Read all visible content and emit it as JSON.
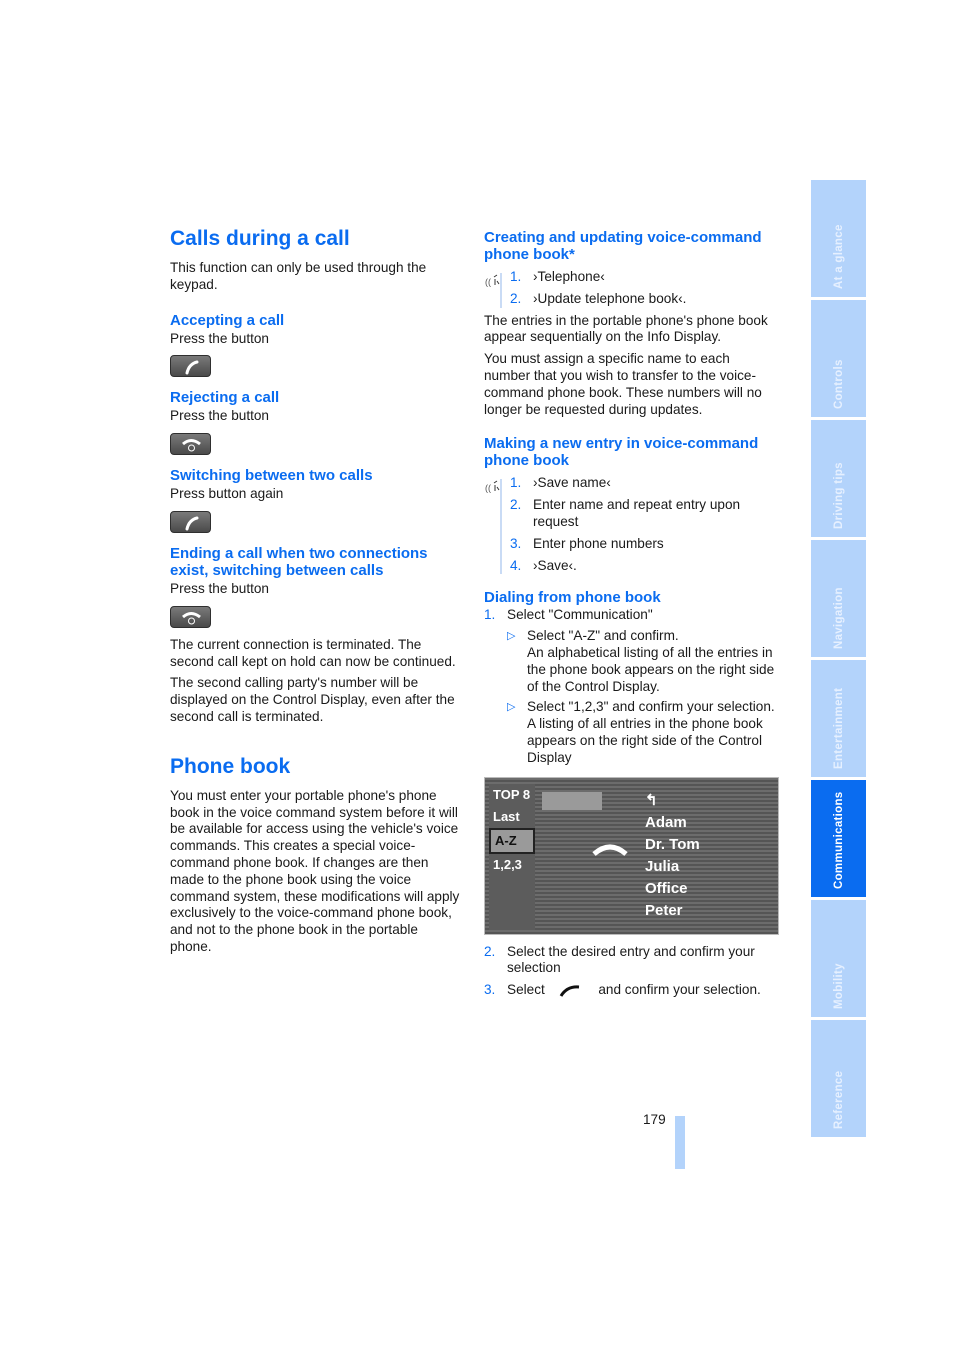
{
  "left": {
    "title": "Calls during a call",
    "intro": "This function can only be used through the keypad.",
    "sections": [
      {
        "heading": "Accepting a call",
        "text": "Press the button",
        "button": "call-accept"
      },
      {
        "heading": "Rejecting a call",
        "text": "Press the button",
        "button": "call-end"
      },
      {
        "heading": "Switching between two calls",
        "text": "Press button again",
        "button": "call-accept"
      },
      {
        "heading": "Ending a call when two connections exist, switching between calls",
        "text": "Press the button",
        "button": "call-end"
      }
    ],
    "para1": "The current connection is terminated. The second call kept on hold can now be continued.",
    "para2": "The second calling party's number will be displayed on the Control Display, even after the second call is terminated.",
    "phonebook_title": "Phone book",
    "phonebook_text": "You must enter your portable phone's phone book in the voice command system before it will be available for access using the vehicle's voice commands. This creates a special voice-command phone book. If changes are then made to the phone book using the voice command system, these modifications will apply exclusively to the voice-command phone book, and not to the phone book in the portable phone."
  },
  "right": {
    "creating_heading": "Creating and updating voice-command phone book*",
    "creating_steps": [
      {
        "num": "1.",
        "text": "›Telephone‹"
      },
      {
        "num": "2.",
        "text": "›Update telephone book‹."
      }
    ],
    "para1": "The entries in the portable phone's phone book appear sequentially on the Info Display.",
    "para2": "You must assign a specific name to each number that you wish to transfer to the voice-command phone book. These numbers will no longer be requested during updates.",
    "making_heading": "Making a new entry in voice-command phone book",
    "making_steps": [
      {
        "num": "1.",
        "text": "›Save name‹"
      },
      {
        "num": "2.",
        "text": "Enter name and repeat entry upon request"
      },
      {
        "num": "3.",
        "text": "Enter phone numbers"
      },
      {
        "num": "4.",
        "text": "›Save‹."
      }
    ],
    "dialing_heading": "Dialing from phone book",
    "dialing_step1": {
      "num": "1.",
      "text": "Select \"Communication\""
    },
    "dialing_subs": [
      "Select \"A-Z\" and confirm.\nAn alphabetical listing of all the entries in the phone book appears on the right side of the Control Display.",
      "Select \"1,2,3\" and confirm your selection.\nA listing of all entries in the phone book appears on the right side of the Control Display"
    ],
    "screen": {
      "menu": [
        "TOP 8",
        "Last",
        "A-Z",
        "1,2,3"
      ],
      "selected": "A-Z",
      "names": [
        "Adam",
        "Dr. Tom",
        "Julia",
        "Office",
        "Peter"
      ]
    },
    "dialing_step2": {
      "num": "2.",
      "text": "Select the desired entry and confirm your selection"
    },
    "dialing_step3": {
      "num": "3.",
      "text_before": "Select",
      "text_after": "and confirm your selection."
    }
  },
  "page_number": "179",
  "tabs": [
    {
      "label": "At a glance",
      "active": false
    },
    {
      "label": "Controls",
      "active": false
    },
    {
      "label": "Driving tips",
      "active": false
    },
    {
      "label": "Navigation",
      "active": false
    },
    {
      "label": "Entertainment",
      "active": false
    },
    {
      "label": "Communications",
      "active": true
    },
    {
      "label": "Mobility",
      "active": false
    },
    {
      "label": "Reference",
      "active": false
    }
  ]
}
